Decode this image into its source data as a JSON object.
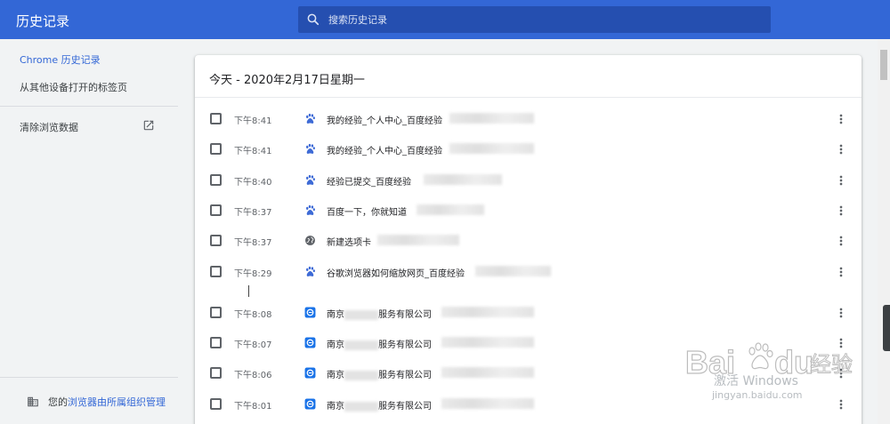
{
  "header": {
    "title": "历史记录",
    "search_placeholder": "搜索历史记录"
  },
  "sidebar": {
    "items": [
      {
        "label": "Chrome 历史记录"
      },
      {
        "label": "从其他设备打开的标签页"
      },
      {
        "label": "清除浏览数据"
      }
    ],
    "management_prefix": "您的",
    "management_link": "浏览器由所属组织管理"
  },
  "main": {
    "date_heading": "今天 - 2020年2月17日星期一",
    "entries": [
      {
        "time": "下午8:41",
        "title": "我的经验_个人中心_百度经验",
        "icon": "baidu-paw-icon"
      },
      {
        "time": "下午8:41",
        "title": "我的经验_个人中心_百度经验",
        "icon": "baidu-paw-icon"
      },
      {
        "time": "下午8:40",
        "title": "经验已提交_百度经验",
        "icon": "baidu-paw-icon"
      },
      {
        "time": "下午8:37",
        "title": "百度一下，你就知道",
        "icon": "baidu-paw-icon"
      },
      {
        "time": "下午8:37",
        "title": "新建选项卡",
        "icon": "globe-icon"
      },
      {
        "time": "下午8:29",
        "title": "谷歌浏览器如何缩放网页_百度经验",
        "icon": "baidu-paw-icon"
      },
      {
        "time": "下午8:08",
        "title": "南京",
        "title_suffix": "服务有限公司",
        "icon": "site-e-icon"
      },
      {
        "time": "下午8:07",
        "title": "南京",
        "title_suffix": "服务有限公司",
        "icon": "site-e-icon"
      },
      {
        "time": "下午8:06",
        "title": "南京",
        "title_suffix": "服务有限公司",
        "icon": "site-e-icon"
      },
      {
        "time": "下午8:01",
        "title": "南京",
        "title_suffix": "服务有限公司",
        "icon": "site-e-icon"
      }
    ]
  },
  "watermark": {
    "activate": "激活 Windows",
    "baidu": "Bai",
    "baidu2": "du",
    "baidu_cn": "经验",
    "url": "jingyan.baidu.com"
  },
  "colors": {
    "accent": "#3367d6",
    "header_bg": "#3367d6",
    "search_bg": "#254fb0",
    "link": "#3367d6"
  }
}
